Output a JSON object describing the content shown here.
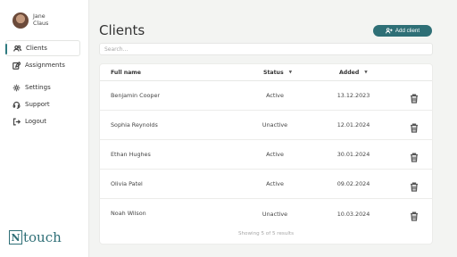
{
  "user": {
    "name_line1": "Jane",
    "name_line2": "Claus"
  },
  "nav": [
    {
      "label": "Clients",
      "icon": "users-icon",
      "active": true
    },
    {
      "label": "Assignments",
      "icon": "edit-icon"
    },
    {
      "label": "Settings",
      "icon": "gear-icon"
    },
    {
      "label": "Support",
      "icon": "headset-icon"
    },
    {
      "label": "Logout",
      "icon": "logout-icon"
    }
  ],
  "logo": {
    "mark": "N",
    "text": "touch"
  },
  "page": {
    "title": "Clients",
    "add_label": "Add client",
    "search_placeholder": "Search..."
  },
  "table": {
    "headers": {
      "name": "Full name",
      "status": "Status",
      "added": "Added",
      "sort_indicator": "▼"
    },
    "rows": [
      {
        "name": "Benjamin Cooper",
        "status": "Active",
        "added": "13.12.2023"
      },
      {
        "name": "Sophia Reynolds",
        "status": "Unactive",
        "added": "12.01.2024"
      },
      {
        "name": "Ethan Hughes",
        "status": "Active",
        "added": "30.01.2024"
      },
      {
        "name": "Olivia Patel",
        "status": "Active",
        "added": "09.02.2024"
      },
      {
        "name": "Noah Wilson",
        "status": "Unactive",
        "added": "10.03.2024"
      }
    ],
    "footer": "Showing 5 of 5 results"
  },
  "colors": {
    "accent": "#2e6f76"
  }
}
